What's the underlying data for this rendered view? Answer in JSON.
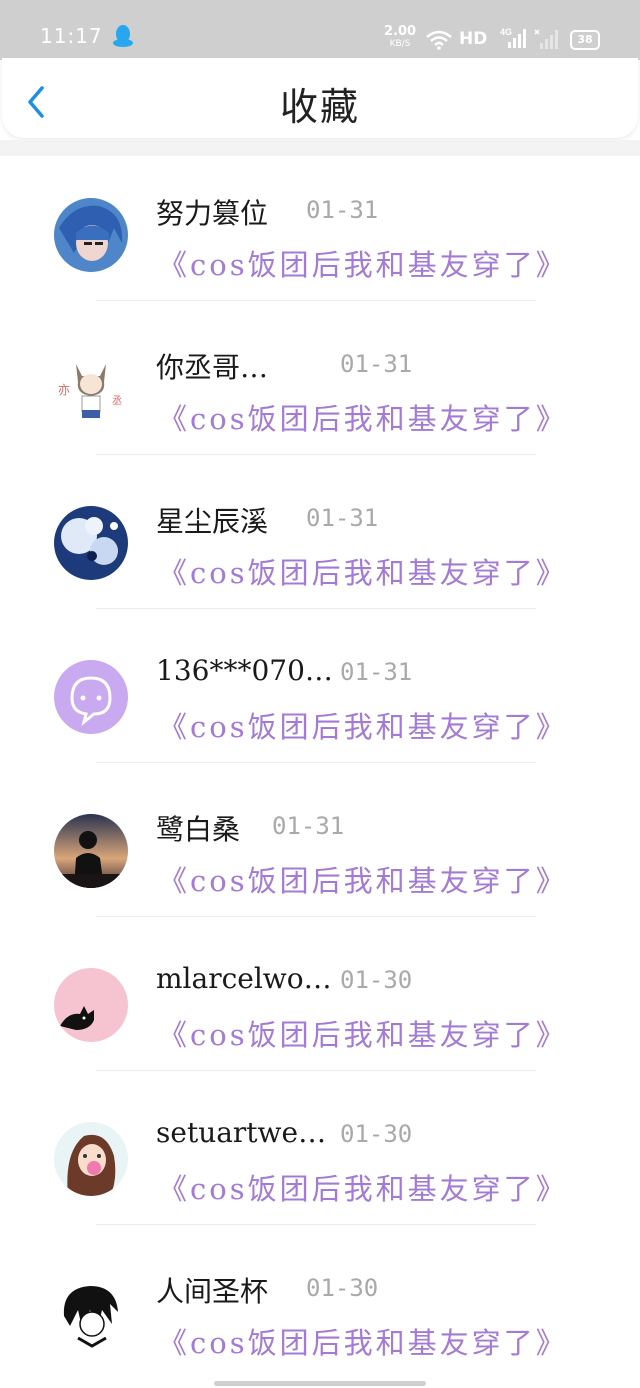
{
  "status_bar": {
    "time": "11:17",
    "speed_value": "2.00",
    "speed_unit": "KB/S",
    "hd": "HD",
    "network": "4G",
    "battery": "38"
  },
  "header": {
    "title": "收藏",
    "accent_color": "#1e8ee6"
  },
  "colors": {
    "post_text": "#a37bd6",
    "date_text": "#a9a9a9"
  },
  "items": [
    {
      "name": "努力篡位",
      "date": "01-31",
      "post": "《cos饭团后我和基友穿了》"
    },
    {
      "name": "你丞哥…",
      "date": "01-31",
      "post": "《cos饭团后我和基友穿了》"
    },
    {
      "name": "星尘辰溪",
      "date": "01-31",
      "post": "《cos饭团后我和基友穿了》"
    },
    {
      "name": "136***070…",
      "date": "01-31",
      "post": "《cos饭团后我和基友穿了》"
    },
    {
      "name": "鹭白桑",
      "date": "01-31",
      "post": "《cos饭团后我和基友穿了》"
    },
    {
      "name": "mlarcelwo…",
      "date": "01-30",
      "post": "《cos饭团后我和基友穿了》"
    },
    {
      "name": "setuartwe…",
      "date": "01-30",
      "post": "《cos饭团后我和基友穿了》"
    },
    {
      "name": "人间圣杯",
      "date": "01-30",
      "post": "《cos饭团后我和基友穿了》"
    }
  ]
}
